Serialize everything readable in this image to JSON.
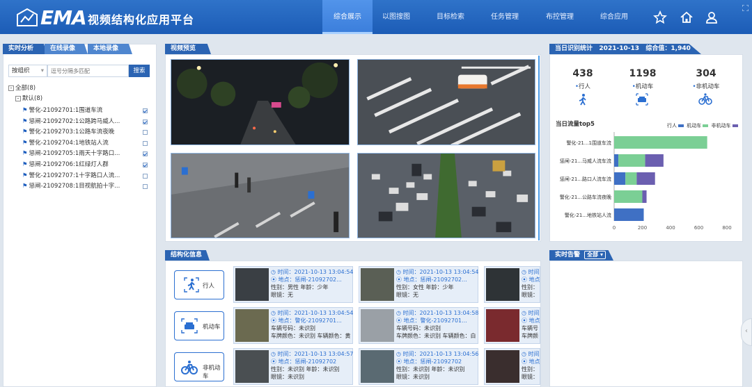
{
  "header": {
    "brand": "EMA",
    "app_title": "视频结构化应用平台",
    "nav": [
      "综合展示",
      "以图搜图",
      "目标检索",
      "任务管理",
      "布控管理",
      "综合应用"
    ],
    "active_nav": 0,
    "icons": [
      "star-icon",
      "home-icon",
      "user-icon"
    ]
  },
  "left_panel": {
    "tabs": [
      "实时分析",
      "在线录像",
      "本地录像"
    ],
    "filter_select": "按组织",
    "search_placeholder": "逗号分隔多匹配",
    "search_button": "搜索",
    "tree_root": "全部(8)",
    "tree_group": "默认(8)",
    "channels": [
      {
        "label": "警化-21092701:1围道车流",
        "checked": true
      },
      {
        "label": "惩闸-21092702:1公路跨马威人...",
        "checked": true
      },
      {
        "label": "警化-21092703:1公路车流夜晚",
        "checked": false
      },
      {
        "label": "警化-21092704:1地铁站人流",
        "checked": false
      },
      {
        "label": "惩闸-21092705:1雨天十字路口...",
        "checked": true
      },
      {
        "label": "惩闸-21092706:1红绿灯人群",
        "checked": true
      },
      {
        "label": "警化-21092707:1十字路口人流...",
        "checked": false
      },
      {
        "label": "惩闸-21092708:1目视航拍十字...",
        "checked": false
      }
    ]
  },
  "video_panel": {
    "title": "视频预览"
  },
  "stats_panel": {
    "title": "当日识别统计",
    "date": "2021-10-13",
    "total_label": "综合值：1,940",
    "stats": [
      {
        "value": "438",
        "label": "行人",
        "icon": "pedestrian-icon"
      },
      {
        "value": "1198",
        "label": "机动车",
        "icon": "car-icon"
      },
      {
        "value": "304",
        "label": "非机动车",
        "icon": "bicycle-icon"
      }
    ]
  },
  "chart_data": {
    "type": "bar",
    "title": "当日流量top5",
    "legend": [
      "行人",
      "机动车",
      "非机动车"
    ],
    "legend_position": "top-right",
    "colors": [
      "#3f70c4",
      "#7bcf95",
      "#6b5fb0"
    ],
    "categories": [
      "警化-21...1围道车流",
      "惩闸-21...马威人流车流",
      "惩闸-21...路口人流车流",
      "警化-21...公路车流夜晚",
      "警化-21...地铁站人流"
    ],
    "series": [
      {
        "name": "行人",
        "values": [
          0,
          30,
          80,
          0,
          210
        ]
      },
      {
        "name": "机动车",
        "values": [
          660,
          190,
          80,
          200,
          0
        ]
      },
      {
        "name": "非机动车",
        "values": [
          0,
          130,
          130,
          30,
          0
        ]
      }
    ],
    "xlim": [
      0,
      800
    ],
    "xticks": [
      "0",
      "200",
      "400",
      "600",
      "800"
    ]
  },
  "struct_panel": {
    "title": "结构化信息",
    "categories": [
      {
        "label": "行人",
        "icon": "pedestrian-icon"
      },
      {
        "label": "机动车",
        "icon": "car-icon"
      },
      {
        "label": "非机动车",
        "icon": "bicycle-icon"
      }
    ],
    "cards": [
      [
        [
          "时间：2021-10-13 13:04:54",
          "地点：惩闸-21092702...",
          "性别：男性    年龄：少年",
          "眼镜：无"
        ],
        [
          "时间：2021-10-13 13:04:54",
          "地点：惩闸-21092702...",
          "性别：女性    年龄：少年",
          "眼镜：无"
        ],
        [
          "时间",
          "地点",
          "性别：",
          "眼镜："
        ]
      ],
      [
        [
          "时间：2021-10-13 13:04:54",
          "地点：警化-21092701...",
          "车辆号码：未识别",
          "车牌颜色：未识别   车辆颜色：黄"
        ],
        [
          "时间：2021-10-13 13:04:58",
          "地点：警化-21092701...",
          "车辆号码：未识别",
          "车牌颜色：未识别   车辆颜色：白"
        ],
        [
          "时间",
          "地点",
          "车辆号",
          "车牌颜"
        ]
      ],
      [
        [
          "时间：2021-10-13 13:04:57",
          "地点：惩闸-21092702",
          "性别：未识别    年龄：未识别",
          "眼镜：未识别"
        ],
        [
          "时间：2021-10-13 13:04:56",
          "地点：惩闸-21092702",
          "性别：未识别    年龄：未识别",
          "眼镜：未识别"
        ],
        [
          "时间",
          "地点",
          "性别：",
          "眼镜："
        ]
      ]
    ]
  },
  "alarm_panel": {
    "title": "实时告警",
    "filter": "全部"
  }
}
